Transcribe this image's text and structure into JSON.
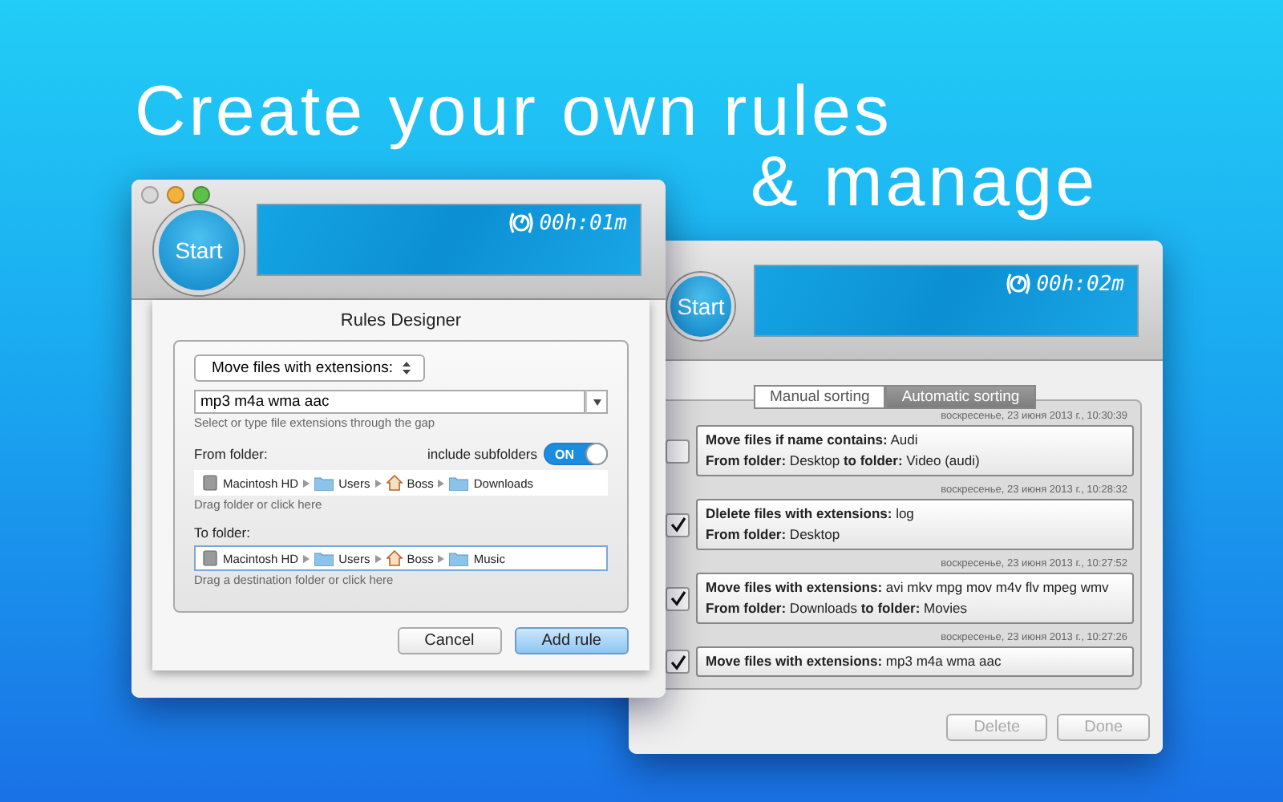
{
  "headline": [
    "Create your own rules",
    "& manage"
  ],
  "back_window": {
    "start_label": "Start",
    "timer": "00h:02m",
    "tabs": [
      {
        "label": "Manual sorting",
        "selected": false
      },
      {
        "label": "Automatic sorting",
        "selected": true
      }
    ],
    "rules": [
      {
        "date": "воскресенье, 23 июня 2013 г., 10:30:39",
        "checked": false,
        "lines": [
          "**Move files if name contains:** Audi",
          "**From folder:** Desktop  **to folder:** Video (audi)"
        ]
      },
      {
        "date": "воскресенье, 23 июня 2013 г., 10:28:32",
        "checked": true,
        "lines": [
          "**Dlelete files with extensions:** log",
          "**From folder:** Desktop"
        ]
      },
      {
        "date": "воскресенье, 23 июня 2013 г., 10:27:52",
        "checked": true,
        "lines": [
          "**Move files with extensions:** avi mkv mpg mov m4v flv mpeg wmv",
          "**From folder:** Downloads  **to folder:** Movies"
        ]
      },
      {
        "date": "воскресенье, 23 июня 2013 г., 10:27:26",
        "checked": true,
        "lines": [
          "**Move files with extensions:** mp3 m4a wma aac"
        ]
      }
    ],
    "buttons": [
      {
        "label": "Delete",
        "disabled": true
      },
      {
        "label": "Done",
        "disabled": true
      }
    ]
  },
  "front_window": {
    "start_label": "Start",
    "timer": "00h:01m",
    "dialog": {
      "title": "Rules Designer",
      "action_popup": "Move files with extensions:",
      "extensions": "mp3 m4a wma aac",
      "extensions_hint": "Select or type file extensions through the gap",
      "from_label": "From folder:",
      "subfolders_label": "include subfolders",
      "subfolders_toggle": {
        "label": "ON",
        "on": true
      },
      "from_path": [
        {
          "kind": "disk",
          "name": "Macintosh HD"
        },
        {
          "kind": "folder",
          "name": "Users"
        },
        {
          "kind": "home",
          "name": "Boss"
        },
        {
          "kind": "folder",
          "name": "Downloads"
        }
      ],
      "from_hint": "Drag folder or click here",
      "to_label": "To folder:",
      "to_path": [
        {
          "kind": "disk",
          "name": "Macintosh HD"
        },
        {
          "kind": "folder",
          "name": "Users"
        },
        {
          "kind": "home",
          "name": "Boss"
        },
        {
          "kind": "folder",
          "name": "Music"
        }
      ],
      "to_hint": "Drag a destination folder or click here",
      "buttons": [
        {
          "label": "Cancel",
          "default": false
        },
        {
          "label": "Add rule",
          "default": true
        }
      ]
    }
  }
}
